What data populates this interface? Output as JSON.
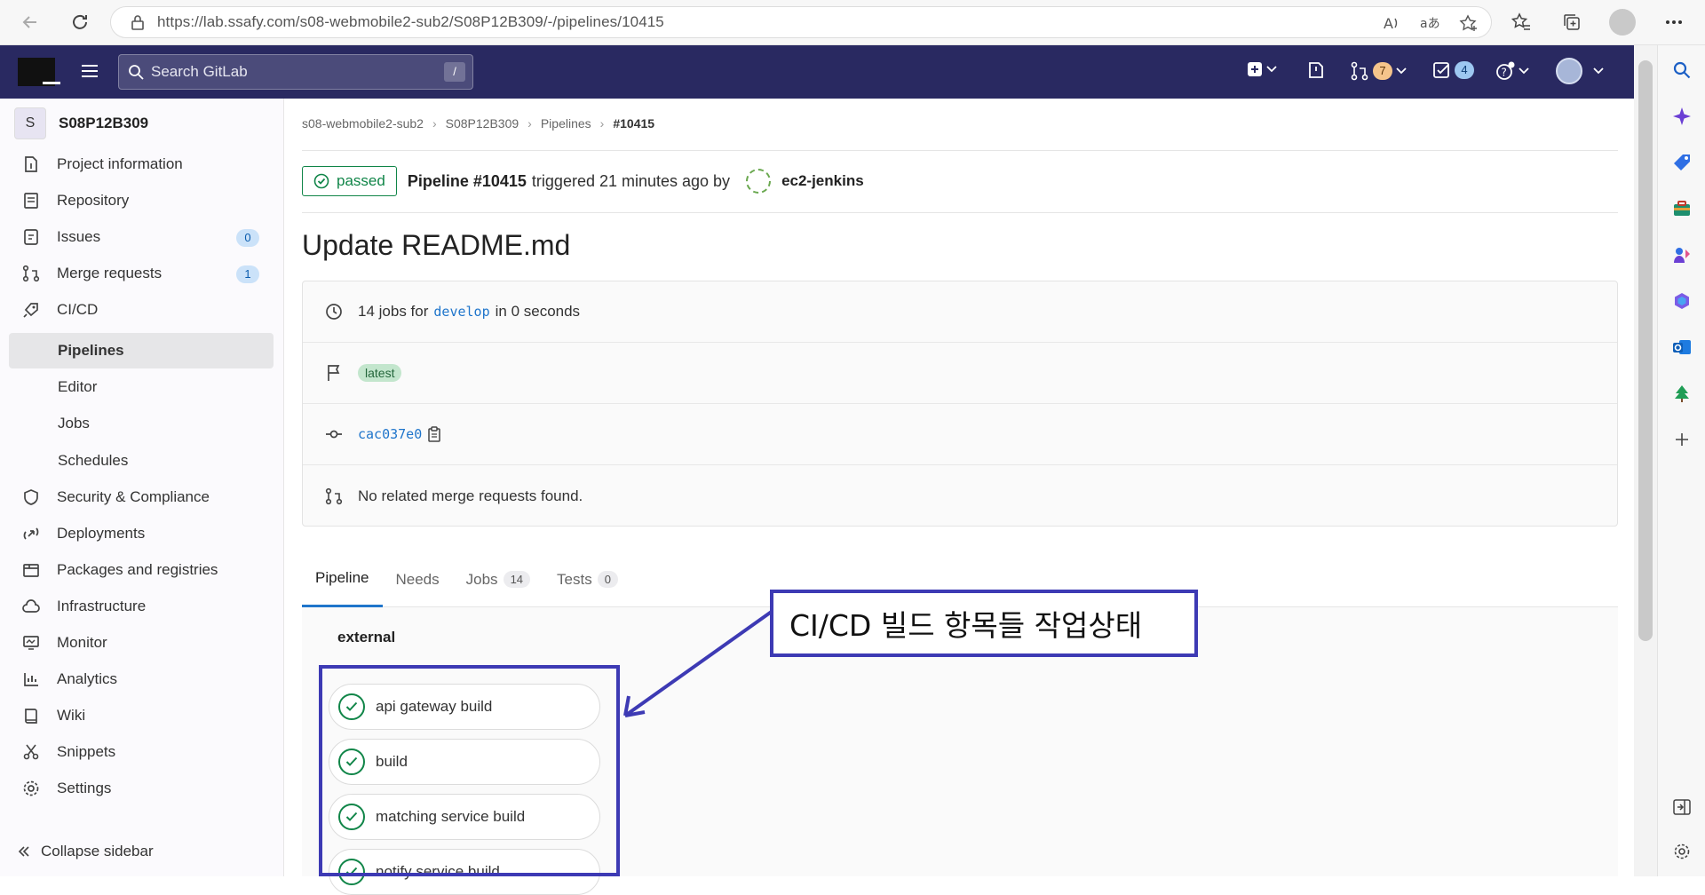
{
  "browser": {
    "url": "https://lab.ssafy.com/s08-webmobile2-sub2/S08P12B309/-/pipelines/10415"
  },
  "topbar": {
    "search_placeholder": "Search GitLab",
    "search_shortcut": "/",
    "merge_requests_count": "7",
    "todos_count": "4"
  },
  "sidebar": {
    "project_initial": "S",
    "project_name": "S08P12B309",
    "items": [
      {
        "label": "Project information",
        "icon": "info-icon"
      },
      {
        "label": "Repository",
        "icon": "doc-icon"
      },
      {
        "label": "Issues",
        "icon": "issues-icon",
        "count": "0"
      },
      {
        "label": "Merge requests",
        "icon": "merge-icon",
        "count": "1"
      },
      {
        "label": "CI/CD",
        "icon": "rocket-icon"
      },
      {
        "label": "Pipelines",
        "sub": true,
        "active": true
      },
      {
        "label": "Editor",
        "sub": true
      },
      {
        "label": "Jobs",
        "sub": true
      },
      {
        "label": "Schedules",
        "sub": true
      },
      {
        "label": "Security & Compliance",
        "icon": "shield-icon"
      },
      {
        "label": "Deployments",
        "icon": "deploy-icon"
      },
      {
        "label": "Packages and registries",
        "icon": "package-icon"
      },
      {
        "label": "Infrastructure",
        "icon": "cloud-icon"
      },
      {
        "label": "Monitor",
        "icon": "monitor-icon"
      },
      {
        "label": "Analytics",
        "icon": "chart-icon"
      },
      {
        "label": "Wiki",
        "icon": "book-icon"
      },
      {
        "label": "Snippets",
        "icon": "scissors-icon"
      },
      {
        "label": "Settings",
        "icon": "gear-icon"
      }
    ],
    "collapse_label": "Collapse sidebar"
  },
  "breadcrumb": [
    "s08-webmobile2-sub2",
    "S08P12B309",
    "Pipelines",
    "#10415"
  ],
  "pipeline": {
    "status": "passed",
    "id_label": "Pipeline #10415",
    "triggered_text": "triggered 21 minutes ago by",
    "user": "ec2-jenkins",
    "commit_title": "Update README.md",
    "jobs_prefix": "14 jobs for",
    "branch": "develop",
    "jobs_suffix": "in 0 seconds",
    "badge": "latest",
    "sha": "cac037e0",
    "mr_text": "No related merge requests found."
  },
  "tabs": [
    {
      "label": "Pipeline",
      "active": true
    },
    {
      "label": "Needs"
    },
    {
      "label": "Jobs",
      "count": "14"
    },
    {
      "label": "Tests",
      "count": "0"
    }
  ],
  "graph": {
    "stage": "external",
    "jobs": [
      "api gateway build",
      "build",
      "matching service build",
      "notify service build"
    ]
  },
  "annotation": {
    "callout_text": "CI/CD 빌드 항목들 작업상태",
    "color": "#3d3ab4"
  }
}
